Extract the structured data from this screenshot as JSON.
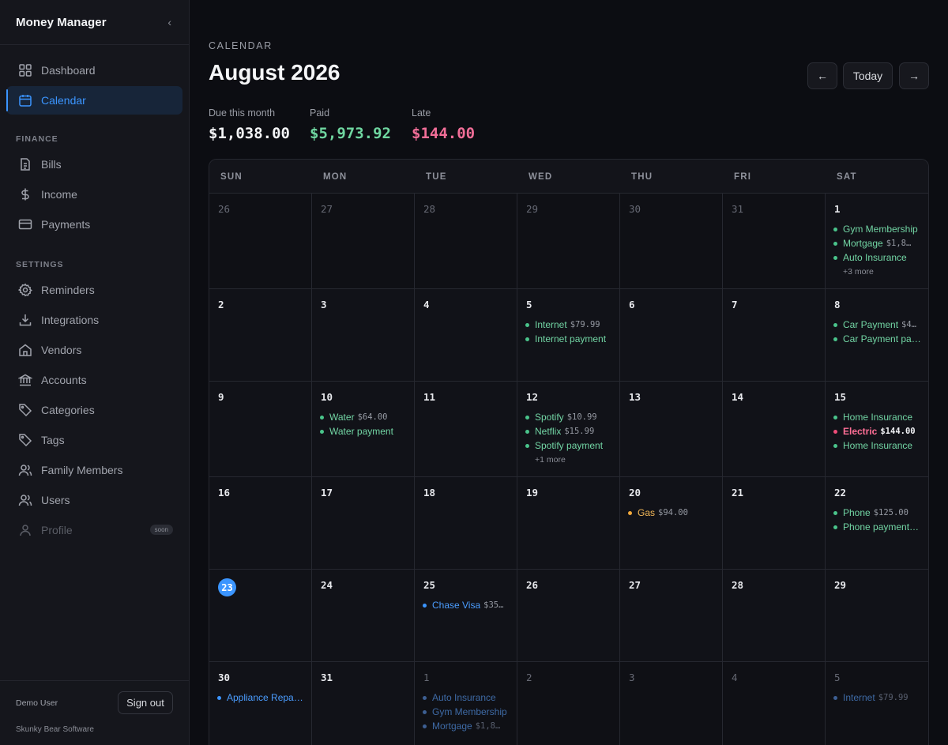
{
  "app": {
    "name": "Money Manager"
  },
  "sidebar": {
    "items": [
      {
        "id": "dashboard",
        "label": "Dashboard",
        "icon": "dashboard-icon"
      },
      {
        "id": "calendar",
        "label": "Calendar",
        "icon": "calendar-icon",
        "active": true
      }
    ],
    "finance": {
      "label": "FINANCE",
      "items": [
        {
          "id": "bills",
          "label": "Bills",
          "icon": "document-icon"
        },
        {
          "id": "income",
          "label": "Income",
          "icon": "dollar-icon"
        },
        {
          "id": "payments",
          "label": "Payments",
          "icon": "card-icon"
        }
      ]
    },
    "settings": {
      "label": "SETTINGS",
      "items": [
        {
          "id": "reminders",
          "label": "Reminders",
          "icon": "gear-icon"
        },
        {
          "id": "integrations",
          "label": "Integrations",
          "icon": "download-icon"
        },
        {
          "id": "vendors",
          "label": "Vendors",
          "icon": "home-icon"
        },
        {
          "id": "accounts",
          "label": "Accounts",
          "icon": "bank-icon"
        },
        {
          "id": "categories",
          "label": "Categories",
          "icon": "tag-icon"
        },
        {
          "id": "tags",
          "label": "Tags",
          "icon": "tag-icon"
        },
        {
          "id": "family-members",
          "label": "Family Members",
          "icon": "users-icon"
        },
        {
          "id": "users",
          "label": "Users",
          "icon": "users-icon"
        },
        {
          "id": "profile",
          "label": "Profile",
          "icon": "user-icon",
          "badge": "soon",
          "disabled": true
        }
      ]
    },
    "footer": {
      "user": "Demo User",
      "sign_out": "Sign out",
      "company": "Skunky Bear Software"
    }
  },
  "header": {
    "eyebrow": "CALENDAR",
    "title": "August 2026",
    "prev": "←",
    "today": "Today",
    "next": "→"
  },
  "summary": {
    "due_label": "Due this month",
    "due_value": "$1,038.00",
    "paid_label": "Paid",
    "paid_value": "$5,973.92",
    "late_label": "Late",
    "late_value": "$144.00"
  },
  "colors": {
    "accent": "#3b95ff",
    "paid": "#6fd6a0",
    "late": "#f26e98",
    "pending": "#f3b857"
  },
  "calendar": {
    "weekdays": [
      "SUN",
      "MON",
      "TUE",
      "WED",
      "THU",
      "FRI",
      "SAT"
    ],
    "cells": [
      {
        "day": "26",
        "current": false,
        "events": []
      },
      {
        "day": "27",
        "current": false,
        "events": []
      },
      {
        "day": "28",
        "current": false,
        "events": []
      },
      {
        "day": "29",
        "current": false,
        "events": []
      },
      {
        "day": "30",
        "current": false,
        "events": []
      },
      {
        "day": "31",
        "current": false,
        "events": []
      },
      {
        "day": "1",
        "current": true,
        "events": [
          {
            "name": "Gym Membership",
            "amount": "",
            "status": "green"
          },
          {
            "name": "Mortgage",
            "amount": "$1,8…",
            "status": "green"
          },
          {
            "name": "Auto Insurance",
            "amount": "",
            "status": "green"
          }
        ],
        "more": "+3 more"
      },
      {
        "day": "2",
        "current": true,
        "events": []
      },
      {
        "day": "3",
        "current": true,
        "events": []
      },
      {
        "day": "4",
        "current": true,
        "events": []
      },
      {
        "day": "5",
        "current": true,
        "events": [
          {
            "name": "Internet",
            "amount": "$79.99",
            "status": "green"
          },
          {
            "name": "Internet payment",
            "amount": "",
            "status": "green"
          }
        ]
      },
      {
        "day": "6",
        "current": true,
        "events": []
      },
      {
        "day": "7",
        "current": true,
        "events": []
      },
      {
        "day": "8",
        "current": true,
        "events": [
          {
            "name": "Car Payment",
            "amount": "$4…",
            "status": "green"
          },
          {
            "name": "Car Payment pa…",
            "amount": "",
            "status": "green"
          }
        ]
      },
      {
        "day": "9",
        "current": true,
        "events": []
      },
      {
        "day": "10",
        "current": true,
        "events": [
          {
            "name": "Water",
            "amount": "$64.00",
            "status": "green"
          },
          {
            "name": "Water payment",
            "amount": "",
            "status": "green"
          }
        ]
      },
      {
        "day": "11",
        "current": true,
        "events": []
      },
      {
        "day": "12",
        "current": true,
        "events": [
          {
            "name": "Spotify",
            "amount": "$10.99",
            "status": "green"
          },
          {
            "name": "Netflix",
            "amount": "$15.99",
            "status": "green"
          },
          {
            "name": "Spotify payment",
            "amount": "",
            "status": "green"
          }
        ],
        "more": "+1 more"
      },
      {
        "day": "13",
        "current": true,
        "events": []
      },
      {
        "day": "14",
        "current": true,
        "events": []
      },
      {
        "day": "15",
        "current": true,
        "events": [
          {
            "name": "Home Insurance",
            "amount": "",
            "status": "green"
          },
          {
            "name": "Electric",
            "amount": "$144.00",
            "status": "red"
          },
          {
            "name": "Home Insurance",
            "amount": "",
            "status": "green"
          }
        ]
      },
      {
        "day": "16",
        "current": true,
        "events": []
      },
      {
        "day": "17",
        "current": true,
        "events": []
      },
      {
        "day": "18",
        "current": true,
        "events": []
      },
      {
        "day": "19",
        "current": true,
        "events": []
      },
      {
        "day": "20",
        "current": true,
        "events": [
          {
            "name": "Gas",
            "amount": "$94.00",
            "status": "orange"
          }
        ]
      },
      {
        "day": "21",
        "current": true,
        "events": []
      },
      {
        "day": "22",
        "current": true,
        "events": [
          {
            "name": "Phone",
            "amount": "$125.00",
            "status": "green"
          },
          {
            "name": "Phone payment…",
            "amount": "",
            "status": "green"
          }
        ]
      },
      {
        "day": "23",
        "current": true,
        "today": true,
        "events": []
      },
      {
        "day": "24",
        "current": true,
        "events": []
      },
      {
        "day": "25",
        "current": true,
        "events": [
          {
            "name": "Chase Visa",
            "amount": "$35…",
            "status": "blue"
          }
        ]
      },
      {
        "day": "26",
        "current": true,
        "events": []
      },
      {
        "day": "27",
        "current": true,
        "events": []
      },
      {
        "day": "28",
        "current": true,
        "events": []
      },
      {
        "day": "29",
        "current": true,
        "events": []
      },
      {
        "day": "30",
        "current": true,
        "events": [
          {
            "name": "Appliance Repa…",
            "amount": "",
            "status": "blue"
          }
        ]
      },
      {
        "day": "31",
        "current": true,
        "events": []
      },
      {
        "day": "1",
        "current": false,
        "events": [
          {
            "name": "Auto Insurance",
            "amount": "",
            "status": "dim"
          },
          {
            "name": "Gym Membership",
            "amount": "",
            "status": "dim"
          },
          {
            "name": "Mortgage",
            "amount": "$1,8…",
            "status": "dim"
          }
        ]
      },
      {
        "day": "2",
        "current": false,
        "events": []
      },
      {
        "day": "3",
        "current": false,
        "events": []
      },
      {
        "day": "4",
        "current": false,
        "events": []
      },
      {
        "day": "5",
        "current": false,
        "events": [
          {
            "name": "Internet",
            "amount": "$79.99",
            "status": "dim"
          }
        ]
      }
    ]
  }
}
